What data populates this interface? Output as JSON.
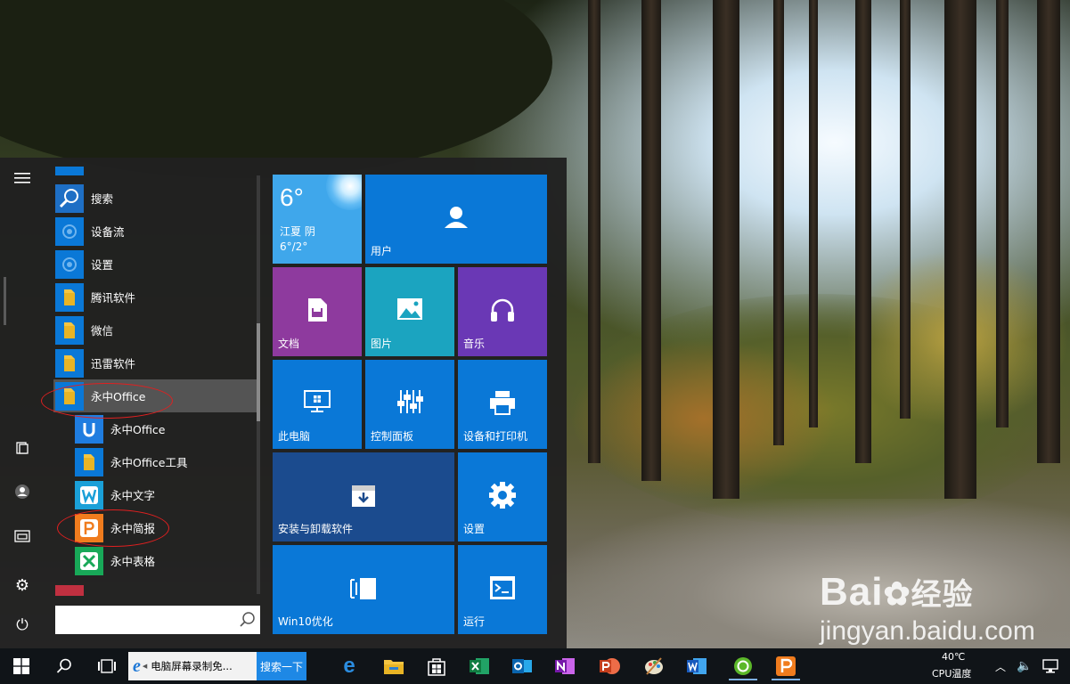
{
  "start_menu": {
    "app_list": [
      {
        "label": "搜索",
        "icon": "search-icon",
        "color": "#1e6fc5"
      },
      {
        "label": "设备流",
        "icon": "gear-icon",
        "color": "#0a78d7"
      },
      {
        "label": "设置",
        "icon": "gear-icon",
        "color": "#0a78d7"
      },
      {
        "label": "腾讯软件",
        "icon": "folder-icon",
        "color": "#0a78d7"
      },
      {
        "label": "微信",
        "icon": "folder-icon",
        "color": "#0a78d7"
      },
      {
        "label": "迅雷软件",
        "icon": "folder-icon",
        "color": "#0a78d7"
      },
      {
        "label": "永中Office",
        "icon": "folder-icon",
        "color": "#0a78d7",
        "expanded": true
      },
      {
        "label": "永中Office",
        "icon": "yozo-office-icon",
        "color": "#1f7de0",
        "sub": true
      },
      {
        "label": "永中Office工具",
        "icon": "folder-icon",
        "color": "#0a78d7",
        "sub": true
      },
      {
        "label": "永中文字",
        "icon": "yozo-writer-icon",
        "color": "#1aa0d8",
        "sub": true
      },
      {
        "label": "永中简报",
        "icon": "yozo-presentation-icon",
        "color": "#f07c1e",
        "sub": true
      },
      {
        "label": "永中表格",
        "icon": "yozo-spreadsheet-icon",
        "color": "#18a858",
        "sub": true
      }
    ],
    "search_placeholder": "",
    "tiles": {
      "weather": {
        "temp": "6°",
        "city": "江夏 阴",
        "range": "6°/2°"
      },
      "user": "用户",
      "documents": "文档",
      "pictures": "图片",
      "music": "音乐",
      "this_pc": "此电脑",
      "control_panel": "控制面板",
      "devices_printers": "设备和打印机",
      "install_uninstall": "安装与卸载软件",
      "settings": "设置",
      "win10_optimize": "Win10优化",
      "run": "运行"
    }
  },
  "taskbar": {
    "ie_title": "电脑屏幕录制免...",
    "search_button": "搜索一下",
    "cpu_temp": "40℃",
    "cpu_label": "CPU温度"
  },
  "watermark": {
    "logo": "Bai",
    "logo_suffix": "经验",
    "url": "jingyan.baidu.com"
  },
  "colors": {
    "accent": "#0a78d7",
    "tile_purple": "#8e3a9e",
    "tile_teal": "#1ba4c0",
    "tile_violet": "#6a38b5",
    "tile_darkblue": "#1b4b8e",
    "weather": "#3fa7eb",
    "highlight_ellipse": "#e02020"
  }
}
